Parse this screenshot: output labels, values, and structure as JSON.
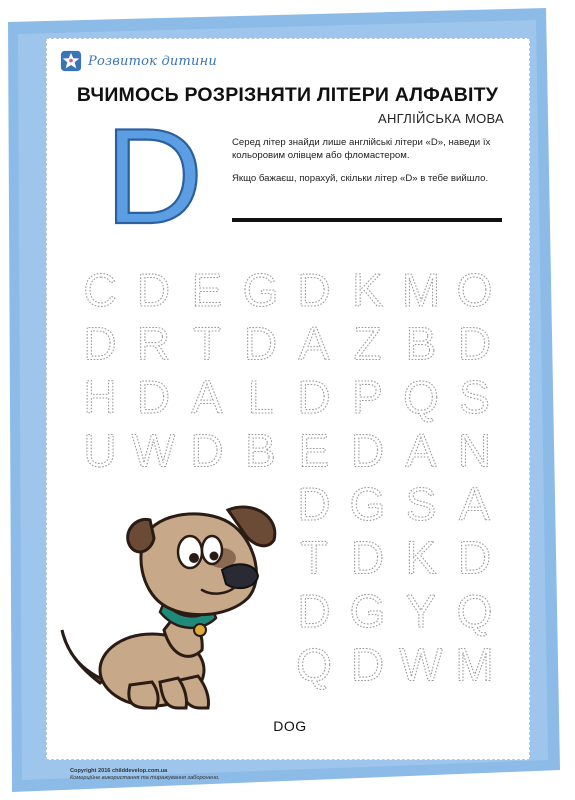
{
  "brand": {
    "name": "Розвиток дитини",
    "icon": "child-star-icon"
  },
  "title": "ВЧИМОСЬ РОЗРІЗНЯТИ ЛІТЕРИ АЛФАВІТУ",
  "subtitle": "АНГЛІЙСЬКА МОВА",
  "target_letter": "D",
  "instructions": [
    "Серед літер знайди лише англійські літери «D», наведи їх кольоровим олівцем або фломастером.",
    "Якщо бажаєш, порахуй, скільки літер «D» в тебе вийшло."
  ],
  "letter_grid": [
    [
      "C",
      "D",
      "E",
      "G",
      "D",
      "K",
      "M",
      "O"
    ],
    [
      "D",
      "R",
      "T",
      "D",
      "A",
      "Z",
      "B",
      "D"
    ],
    [
      "H",
      "D",
      "A",
      "L",
      "D",
      "P",
      "Q",
      "S"
    ],
    [
      "U",
      "W",
      "D",
      "B",
      "E",
      "D",
      "A",
      "N"
    ],
    [
      "",
      "",
      "",
      "",
      "D",
      "G",
      "S",
      "A"
    ],
    [
      "",
      "",
      "",
      "",
      "T",
      "D",
      "K",
      "D"
    ],
    [
      "",
      "",
      "",
      "",
      "D",
      "G",
      "Y",
      "Q"
    ],
    [
      "",
      "",
      "",
      "",
      "Q",
      "D",
      "W",
      "M"
    ]
  ],
  "picture_word": "DOG",
  "copyright": {
    "line1": "Copyright 2016 childdevelop.com.ua",
    "line2": "Комерційне використання та тиражування заборонено."
  },
  "colors": {
    "page_background": "#8cbbe8",
    "brand_blue": "#3a74b8",
    "letter_blue": "#5b9ee3",
    "tracing_gray": "#9a9a9a"
  }
}
